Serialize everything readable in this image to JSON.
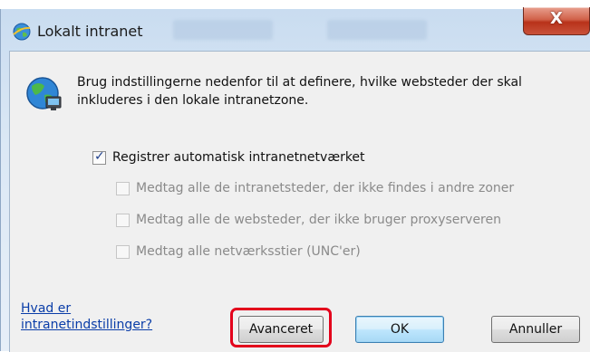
{
  "window": {
    "title": "Lokalt intranet",
    "close_label": "X",
    "icon": "internet-explorer-globe-icon"
  },
  "dialog": {
    "icon": "intranet-globe-icon",
    "description": "Brug indstillingerne nedenfor til at definere, hvilke websteder der skal inkluderes i den lokale intranetzone.",
    "checkboxes": [
      {
        "label": "Registrer automatisk intranetnetværket",
        "checked": true,
        "enabled": true
      },
      {
        "label": "Medtag alle de intranetsteder, der ikke findes i andre zoner",
        "checked": false,
        "enabled": false
      },
      {
        "label": "Medtag alle de websteder, der ikke bruger proxyserveren",
        "checked": false,
        "enabled": false
      },
      {
        "label": "Medtag alle netværksstier (UNC'er)",
        "checked": false,
        "enabled": false
      }
    ],
    "help_link": "Hvad er intranetindstillinger?",
    "buttons": {
      "advanced": "Avanceret",
      "ok": "OK",
      "cancel": "Annuller"
    }
  },
  "colors": {
    "highlight": "#e3001b",
    "link": "#0a3da8",
    "close": "#c9523a"
  }
}
